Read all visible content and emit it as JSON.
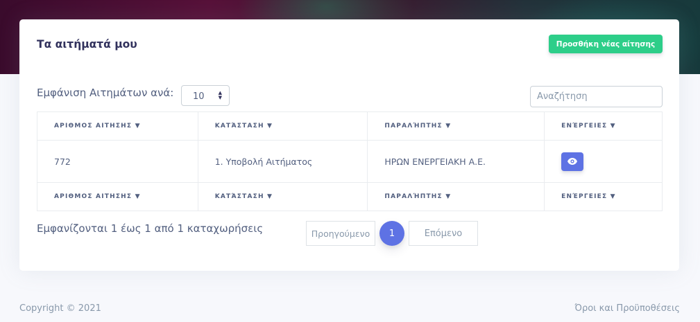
{
  "card": {
    "title": "Τα αιτήματά μου",
    "add_button_label": "Προσθήκη νέας αίτησης"
  },
  "controls": {
    "length_label": "Εμφάνιση Αιτημάτων ανά:",
    "length_value": "10",
    "search_placeholder": "Αναζήτηση"
  },
  "table": {
    "columns": [
      "ΑΡΙΘΜΟΣ ΑΙΤΗΣΗΣ ▼",
      "ΚΑΤΆΣΤΑΣΗ ▼",
      "ΠΑΡΑΛΉΠΤΗΣ ▼",
      "ΕΝΈΡΓΕΙΕΣ ▼"
    ],
    "rows": [
      {
        "number": "772",
        "status": "1. Υποβολή Αιτήματος",
        "recipient": "ΗΡΩΝ ΕΝΕΡΓΕΙΑΚΗ Α.Ε."
      }
    ]
  },
  "pagination": {
    "info": "Εμφανίζονται 1 έως 1 από 1 καταχωρήσεις",
    "prev_label": "Προηγούμενο",
    "current_page": "1",
    "next_label": "Επόμενο"
  },
  "footer": {
    "copyright": "Copyright © 2021",
    "terms_link": "Όροι και Προϋποθέσεις"
  },
  "colors": {
    "primary": "#5e72e4",
    "success": "#2dce89"
  },
  "icons": {
    "view": "eye-icon",
    "select": "sort-arrows-icon"
  }
}
